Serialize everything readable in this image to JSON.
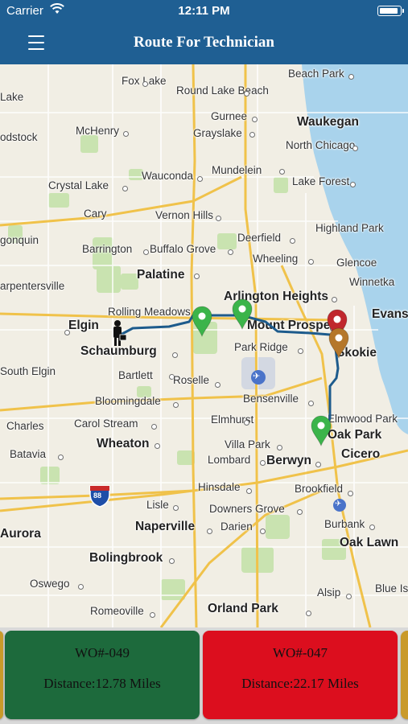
{
  "status_bar": {
    "carrier": "Carrier",
    "time": "12:11 PM"
  },
  "header": {
    "title": "Route For Technician",
    "menu_icon": "hamburger-menu-icon"
  },
  "map": {
    "cities": [
      {
        "name": "Fox Lake",
        "big": false
      },
      {
        "name": "Round Lake Beach",
        "big": false
      },
      {
        "name": "Beach Park",
        "big": false
      },
      {
        "name": "Lake",
        "big": false
      },
      {
        "name": "Gurnee",
        "big": false
      },
      {
        "name": "Waukegan",
        "big": true
      },
      {
        "name": "McHenry",
        "big": false
      },
      {
        "name": "Grayslake",
        "big": false
      },
      {
        "name": "odstock",
        "big": false
      },
      {
        "name": "North Chicago",
        "big": false
      },
      {
        "name": "Wauconda",
        "big": false
      },
      {
        "name": "Mundelein",
        "big": false
      },
      {
        "name": "Crystal Lake",
        "big": false
      },
      {
        "name": "Lake Forest",
        "big": false
      },
      {
        "name": "Cary",
        "big": false
      },
      {
        "name": "Vernon Hills",
        "big": false
      },
      {
        "name": "Highland Park",
        "big": false
      },
      {
        "name": "gonquin",
        "big": false
      },
      {
        "name": "Deerfield",
        "big": false
      },
      {
        "name": "Barrington",
        "big": false
      },
      {
        "name": "Buffalo Grove",
        "big": false
      },
      {
        "name": "Glencoe",
        "big": false
      },
      {
        "name": "Wheeling",
        "big": false
      },
      {
        "name": "Palatine",
        "big": true
      },
      {
        "name": "Winnetka",
        "big": false
      },
      {
        "name": "arpentersville",
        "big": false
      },
      {
        "name": "Arlington Heights",
        "big": true
      },
      {
        "name": "Evans",
        "big": true
      },
      {
        "name": "Rolling Meadows",
        "big": false
      },
      {
        "name": "Elgin",
        "big": true
      },
      {
        "name": "Mount Prospect",
        "big": true
      },
      {
        "name": "Schaumburg",
        "big": true
      },
      {
        "name": "Park Ridge",
        "big": false
      },
      {
        "name": "Skokie",
        "big": true
      },
      {
        "name": "South Elgin",
        "big": false
      },
      {
        "name": "Bartlett",
        "big": false
      },
      {
        "name": "Roselle",
        "big": false
      },
      {
        "name": "Bensenville",
        "big": false
      },
      {
        "name": "Bloomingdale",
        "big": false
      },
      {
        "name": "Elmwood Park",
        "big": false
      },
      {
        "name": "Charles",
        "big": false
      },
      {
        "name": "Carol Stream",
        "big": false
      },
      {
        "name": "Elmhurst",
        "big": false
      },
      {
        "name": "Oak Park",
        "big": true
      },
      {
        "name": "Wheaton",
        "big": true
      },
      {
        "name": "Villa Park",
        "big": false
      },
      {
        "name": "Batavia",
        "big": false
      },
      {
        "name": "Lombard",
        "big": false
      },
      {
        "name": "Berwyn",
        "big": true
      },
      {
        "name": "Cicero",
        "big": true
      },
      {
        "name": "Brookfield",
        "big": false
      },
      {
        "name": "Hinsdale",
        "big": false
      },
      {
        "name": "Lisle",
        "big": false
      },
      {
        "name": "Downers Grove",
        "big": false
      },
      {
        "name": "Burbank",
        "big": false
      },
      {
        "name": "Aurora",
        "big": true
      },
      {
        "name": "Naperville",
        "big": true
      },
      {
        "name": "Darien",
        "big": false
      },
      {
        "name": "Oak Lawn",
        "big": true
      },
      {
        "name": "Bolingbrook",
        "big": true
      },
      {
        "name": "Oswego",
        "big": false
      },
      {
        "name": "Alsip",
        "big": false
      },
      {
        "name": "Blue Is",
        "big": false
      },
      {
        "name": "Romeoville",
        "big": false
      },
      {
        "name": "Orland Park",
        "big": true
      }
    ],
    "highway_shield": "88",
    "markers": [
      {
        "kind": "technician",
        "color": "#111111"
      },
      {
        "kind": "work-order",
        "color": "#3bb44a"
      },
      {
        "kind": "work-order",
        "color": "#3bb44a"
      },
      {
        "kind": "work-order",
        "color": "#c0272d"
      },
      {
        "kind": "work-order",
        "color": "#b5772a"
      },
      {
        "kind": "work-order",
        "color": "#3bb44a"
      }
    ],
    "route_color": "#1d5b8c"
  },
  "work_orders": [
    {
      "wo": "WO#-049",
      "distance": "Distance:12.78 Miles",
      "color": "#1d6a3c"
    },
    {
      "wo": "WO#-047",
      "distance": "Distance:22.17 Miles",
      "color": "#dc0e1e"
    }
  ],
  "colors": {
    "header": "#1f5f93"
  }
}
